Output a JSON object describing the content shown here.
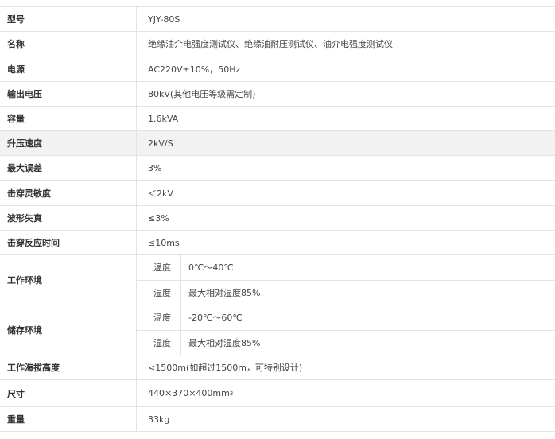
{
  "specs": [
    {
      "label": "型号",
      "value": "YJY-80S"
    },
    {
      "label": "名称",
      "value": "绝缘油介电强度测试仪、绝缘油耐压测试仪、油介电强度测试仪"
    },
    {
      "label": "电源",
      "value": "AC220V±10%，50Hz"
    },
    {
      "label": "输出电压",
      "value": "80kV(其他电压等级需定制)"
    },
    {
      "label": "容量",
      "value": "1.6kVA"
    },
    {
      "label": "升压速度",
      "value": "2kV/S"
    },
    {
      "label": "最大误差",
      "value": "3%"
    },
    {
      "label": "击穿灵敏度",
      "value": "＜2kV"
    },
    {
      "label": "波形失真",
      "value": "≤3%"
    },
    {
      "label": "击穿反应时间",
      "value": "≤10ms"
    }
  ],
  "work_env": {
    "label": "工作环境",
    "rows": [
      {
        "label": "温度",
        "value": "0℃～40℃"
      },
      {
        "label": "湿度",
        "value": "最大相对湿度85%"
      }
    ]
  },
  "storage_env": {
    "label": "储存环境",
    "rows": [
      {
        "label": "温度",
        "value": "-20℃～60℃"
      },
      {
        "label": "湿度",
        "value": "最大相对湿度85%"
      }
    ]
  },
  "altitude": {
    "label": "工作海拔高度",
    "value": "<1500m(如超过1500m，可特别设计)"
  },
  "size": {
    "label": "尺寸",
    "value": "440×370×400mm",
    "superscript": "3"
  },
  "weight": {
    "label": "重量",
    "value": "33kg"
  }
}
